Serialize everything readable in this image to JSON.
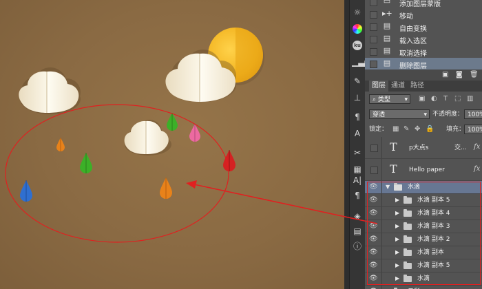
{
  "history": {
    "items": [
      {
        "label": "添加图层蒙版",
        "icon": "mask-icon"
      },
      {
        "label": "移动",
        "icon": "move-icon"
      },
      {
        "label": "自由变换",
        "icon": "document-icon"
      },
      {
        "label": "载入选区",
        "icon": "document-icon"
      },
      {
        "label": "取消选择",
        "icon": "document-icon"
      },
      {
        "label": "删除图层",
        "icon": "document-icon",
        "selected": true
      }
    ]
  },
  "panel_tabs": {
    "layers": "图层",
    "channels": "通道",
    "paths": "路径"
  },
  "layer_controls": {
    "filter_kind": "类型",
    "blend_mode": "穿透",
    "opacity_label": "不透明度：",
    "opacity_value": "100%",
    "lock_label": "锁定：",
    "fill_label": "填充：",
    "fill_value": "100%"
  },
  "layers": [
    {
      "name": "p大点s",
      "extra": "交...",
      "type": "text"
    },
    {
      "name": "Hello paper",
      "type": "text"
    },
    {
      "name": "水滴",
      "type": "group",
      "expanded": true,
      "selected": true
    },
    {
      "name": "水滴 副本 5",
      "type": "group"
    },
    {
      "name": "水滴 副本 4",
      "type": "group"
    },
    {
      "name": "水滴 副本 3",
      "type": "group"
    },
    {
      "name": "水滴 副本 2",
      "type": "group"
    },
    {
      "name": "水滴 副本",
      "type": "group"
    },
    {
      "name": "水滴 副本 5",
      "type": "group"
    },
    {
      "name": "水滴",
      "type": "group"
    },
    {
      "name": "云彩",
      "type": "group"
    }
  ],
  "fx_label": "fx",
  "colors": {
    "canvas_bg": "#8a6a44",
    "panel_bg": "#535353",
    "selection": "#677793",
    "annotation": "#e02020",
    "sun": "#f2b21e",
    "drop_orange": "#e8821a",
    "drop_green": "#3cb028",
    "drop_blue": "#2f6fd0",
    "drop_red": "#d42222",
    "drop_pink": "#ec6aa0"
  }
}
